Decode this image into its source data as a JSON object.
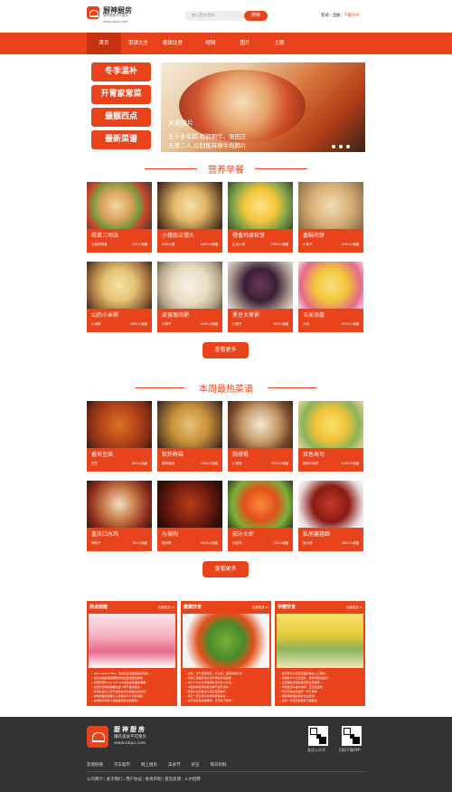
{
  "header": {
    "brand": "厨神厨房",
    "slogan": "懂有美食不可重负",
    "url": "www.caipu.com",
    "search_placeholder": "输入菜名/食材",
    "search_button": "搜索",
    "login": "登录",
    "register": "注册",
    "download": "下载APP"
  },
  "nav": [
    "首页",
    "菜谱大全",
    "健康饮食",
    "视频",
    "图片",
    "主题"
  ],
  "promo": [
    "冬季温补",
    "开胃家常菜",
    "最靓西点",
    "最新菜谱"
  ],
  "banner": {
    "title": "夫妻肺片",
    "desc1": "五十多年前,有郭朝华、张田正",
    "desc2": "夫妻二人,以制售麻辣牛肉肺片"
  },
  "section1": {
    "title": "营养早餐",
    "cards": [
      {
        "name": "简单三明治",
        "author": "甘蓝的味道",
        "favs": "210人收藏",
        "img": "sandwich"
      },
      {
        "name": "小猪南瓜馒头",
        "author": "DSH小厨",
        "favs": "1009人收藏",
        "img": "pumpkin-bun"
      },
      {
        "name": "橙香鸡蛋软饼",
        "author": "生活小事",
        "favs": "1009人收藏",
        "img": "egg-pancake"
      },
      {
        "name": "香酥肉饼",
        "author": "小黄子",
        "favs": "1500人收藏",
        "img": "meat-pie"
      },
      {
        "name": "山药小米粥",
        "author": "小米粥",
        "favs": "3000人收藏",
        "img": "millet-porridge"
      },
      {
        "name": "皮蛋瘦肉粥",
        "author": "小顾子",
        "favs": "2150人收藏",
        "img": "congee"
      },
      {
        "name": "黑豆大枣粥",
        "author": "小顾子",
        "favs": "995人收藏",
        "img": "black-bean-porridge"
      },
      {
        "name": "玉米汤羹",
        "author": "大明",
        "favs": "4120人收藏",
        "img": "corn-soup"
      }
    ]
  },
  "section2": {
    "title": "本周最热菜谱",
    "cards": [
      {
        "name": "香煎豆腐",
        "author": "豆豆",
        "favs": "840人收藏",
        "img": "fried-tofu"
      },
      {
        "name": "软炸鲜菇",
        "author": "厨房美食",
        "favs": "1250人收藏",
        "img": "fried-mushroom"
      },
      {
        "name": "蒜排骨",
        "author": "小丽丽",
        "favs": "3500人收藏",
        "img": "garlic-ribs"
      },
      {
        "name": "双色寿司",
        "author": "厨房小码农",
        "favs": "1250人收藏",
        "img": "sushi"
      },
      {
        "name": "重庆口水鸡",
        "author": "辣味子",
        "favs": "785人收藏",
        "img": "chongqing-chicken"
      },
      {
        "name": "东坡肉",
        "author": "猪肉哥",
        "favs": "4520人收藏",
        "img": "dongpo-pork"
      },
      {
        "name": "茄汁大虾",
        "author": "红老师",
        "favs": "750人收藏",
        "img": "tomato-shrimp"
      },
      {
        "name": "私房酱猪蹄",
        "author": "张大厨",
        "favs": "3652人收藏",
        "img": "pork-trotter"
      }
    ],
    "more": "查看更多"
  },
  "section1_more": "查看更多",
  "columns": [
    {
      "title": "西点烘焙",
      "more": "查看更多 >",
      "img": "pastry",
      "text": "• Red Velvet Cake。他的红丝绒蛋糕是有名的...<br>• 最后浓缩的层层糖粉加热后变得更加美味...<br>• 烘焙师傅Dolce Tart Lab首先把表面的蛋糕...<br>• 烘焙天使特别需要在这个季节做的甜点...<br>• 冬季必备手工饼干做法在家也能做出好味道...<br>• 热吻奶酪的温暖人心的甜点与不同的搭配...<br>• 简单易学的杯子蛋糕做法和注意事项..."
    },
    {
      "title": "健康饮食",
      "more": "查看更多 >",
      "img": "salad",
      "text": "• 立秋，天气变得渐凉，外出游，蔬菜新鲜好吃...<br>• 冬季三款暖身汤让你不再怕冷和感冒...<br>• 吃什么可以让你保持好身材的小方法...<br>• 中医教你如何在秋冬季节进行食补...<br>• 蔬菜沙拉的做法与营养搭配技巧...<br>• 每天一杯豆浆对身体有哪些好处...<br>• 养胃的五种食物推荐，天天吃不伤胃..."
    },
    {
      "title": "孕婴饮食",
      "more": "查看更多 >",
      "img": "baby-food",
      "text": "• 春天里可以给宝宝做的辅食入口即化...<br>• 孕期吃什么对宝宝好，营养师给出建议...<br>• 宝宝辅食添加的顺序和注意事项...<br>• 鸡蛋羹怎么做才嫩滑，宝宝最爱吃...<br>• 孕妇早餐食谱推荐一周不重样...<br>• 哺乳期妈妈的营养饮食安排...<br>• 适合一岁宝宝的营养午餐做法..."
    }
  ],
  "footer": {
    "brand": "厨神厨房",
    "slogan": "懂有美食不可重负",
    "url": "www.caipu.com",
    "qr1_label": "关注公众号",
    "qr2_label": "扫码下载APP",
    "links1": [
      "友情链接",
      "京东超市",
      "网上厨房",
      "美食节",
      "好豆",
      "每日优鲜"
    ],
    "links2": [
      "公司简介",
      "关于我们",
      "用户协议",
      "免责声明",
      "意见反馈",
      "人才招聘"
    ]
  },
  "colors": {
    "accent": "#e8431a",
    "footer": "#333333"
  }
}
